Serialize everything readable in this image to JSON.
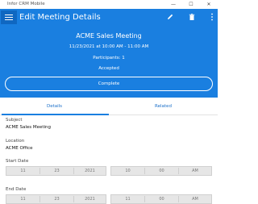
{
  "window": {
    "app_title": "Infor CRM Mobile",
    "minimize_glyph": "—",
    "maximize_glyph": "☐",
    "close_glyph": "✕"
  },
  "header": {
    "page_title": "Edit Meeting Details",
    "meeting_title": "ACME Sales Meeting",
    "meeting_time": "11/23/2021 at 10:00 AM - 11:00 AM",
    "participants": "Participants: 1",
    "status": "Accepted",
    "complete_label": "Complete",
    "colors": {
      "primary": "#1a7fe0",
      "primary_dark": "#0f67c1"
    },
    "icons": [
      "menu-icon",
      "edit-icon",
      "trash-icon",
      "more-icon"
    ]
  },
  "tabs": {
    "details": "Details",
    "related": "Related"
  },
  "form": {
    "subject": {
      "label": "Subject",
      "value": "ACME Sales Meeting"
    },
    "location": {
      "label": "Location",
      "value": "ACME Office"
    },
    "start": {
      "label": "Start Date",
      "month": "11",
      "day": "23",
      "year": "2021",
      "hour": "10",
      "minute": "00",
      "period": "AM"
    },
    "end": {
      "label": "End Date",
      "month": "11",
      "day": "23",
      "year": "2021",
      "hour": "11",
      "minute": "00",
      "period": "AM"
    }
  }
}
